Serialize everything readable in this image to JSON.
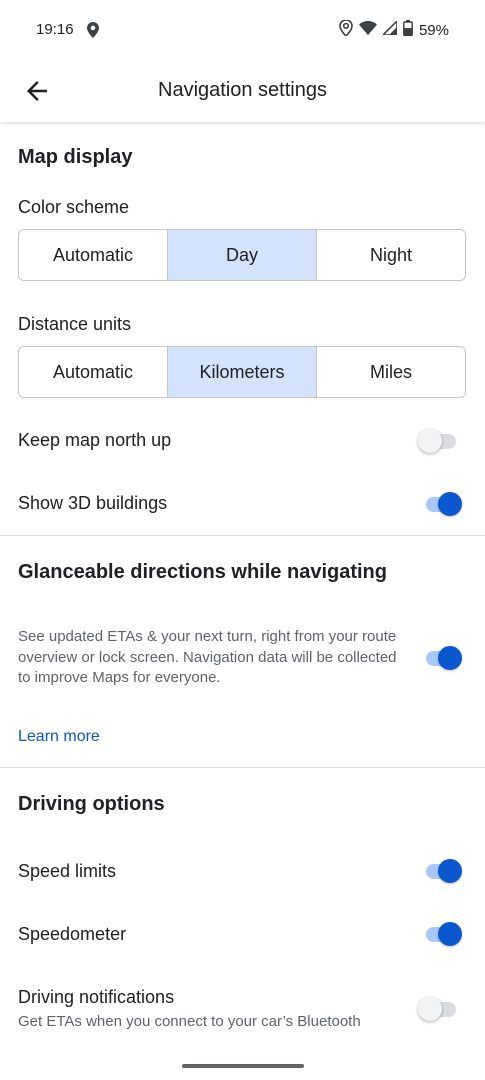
{
  "status_bar": {
    "time": "19:16",
    "battery": "59%"
  },
  "app_bar": {
    "title": "Navigation settings"
  },
  "map_display": {
    "title": "Map display",
    "color_scheme": {
      "label": "Color scheme",
      "options": [
        "Automatic",
        "Day",
        "Night"
      ],
      "selected": "Day"
    },
    "distance_units": {
      "label": "Distance units",
      "options": [
        "Automatic",
        "Kilometers",
        "Miles"
      ],
      "selected": "Kilometers"
    },
    "keep_north_up": {
      "label": "Keep map north up",
      "enabled": false
    },
    "show_3d_buildings": {
      "label": "Show 3D buildings",
      "enabled": true
    }
  },
  "glanceable": {
    "title": "Glanceable directions while navigating",
    "description": "See updated ETAs & your next turn, right from your route overview or lock screen. Navigation data will be collected to improve Maps for everyone.",
    "enabled": true,
    "learn_more": "Learn more"
  },
  "driving_options": {
    "title": "Driving options",
    "speed_limits": {
      "label": "Speed limits",
      "enabled": true
    },
    "speedometer": {
      "label": "Speedometer",
      "enabled": true
    },
    "driving_notifications": {
      "label": "Driving notifications",
      "subtitle": "Get ETAs when you connect to your car’s Bluetooth",
      "enabled": false
    }
  },
  "colors": {
    "accent": "#0b57d0",
    "selected_segment": "#d3e3fd",
    "track_on": "#a8c7fa"
  },
  "icons": [
    "location-icon",
    "wifi-icon",
    "signal-icon",
    "battery-icon",
    "back-arrow-icon"
  ]
}
